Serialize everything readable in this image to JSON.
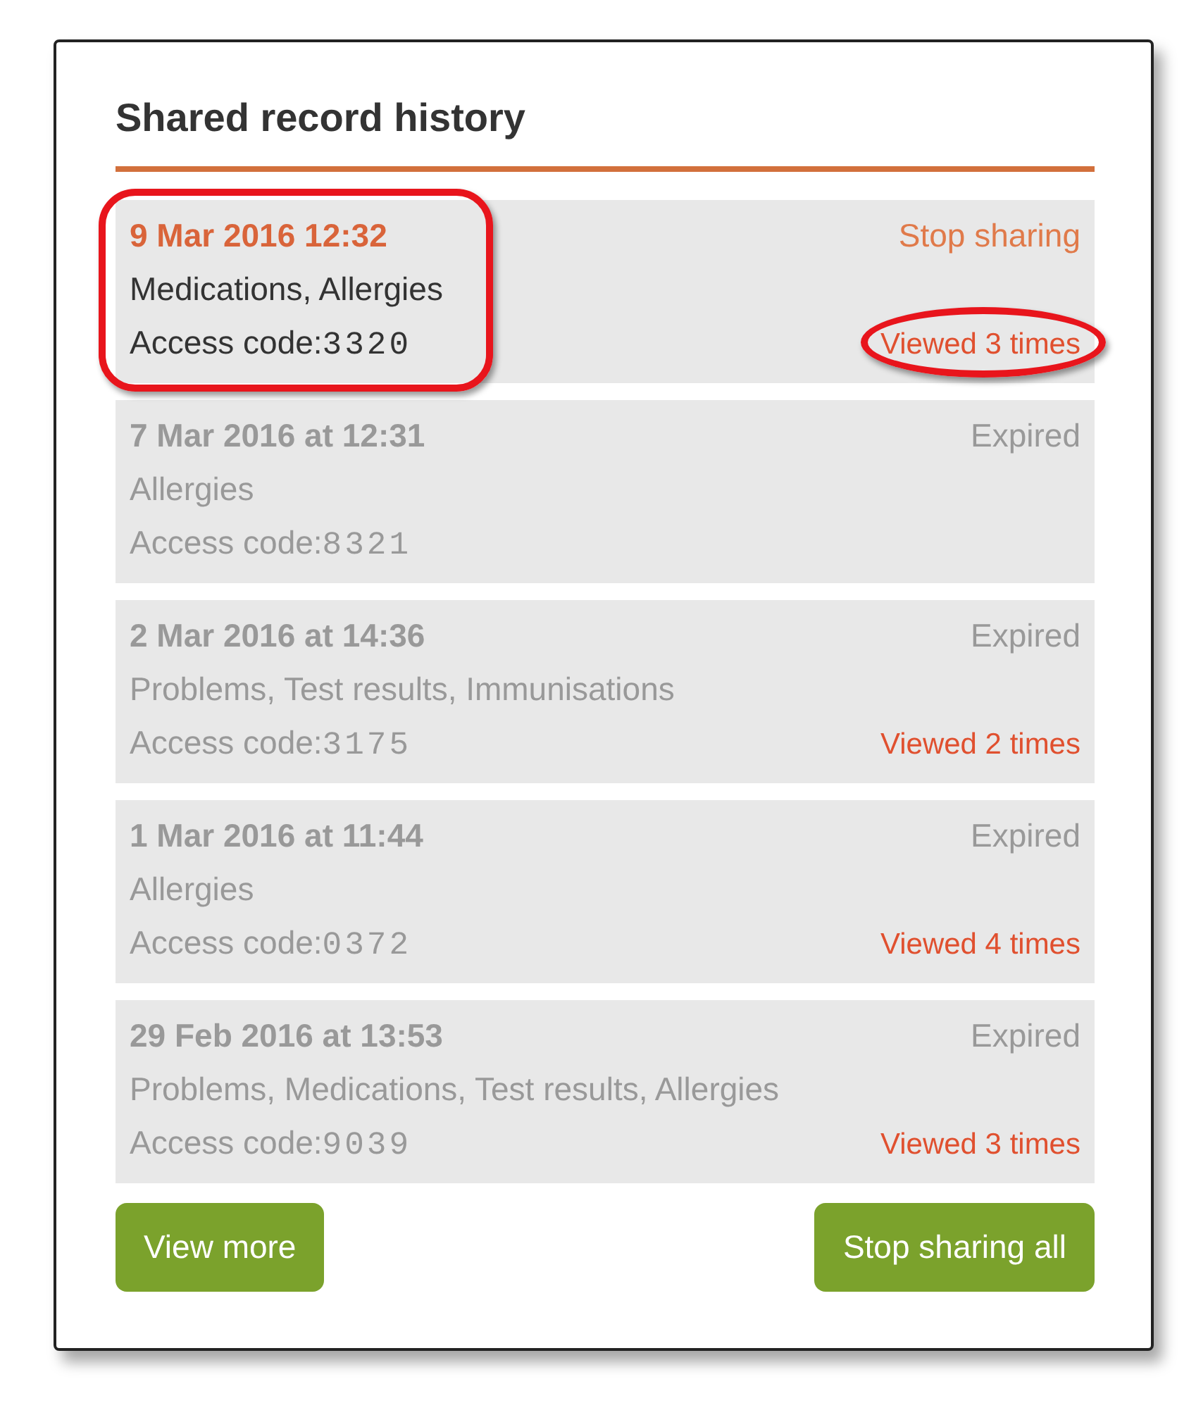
{
  "title": "Shared record history",
  "records": [
    {
      "kind": "active",
      "date": "9 Mar 2016 12:32",
      "items": "Medications, Allergies",
      "code_label": "Access code:",
      "code": "3320",
      "status": "Stop sharing",
      "viewed": "Viewed 3 times",
      "highlighted": true
    },
    {
      "kind": "expired",
      "date": "7 Mar 2016 at 12:31",
      "items": "Allergies",
      "code_label": "Access code:",
      "code": "8321",
      "status": "Expired",
      "highlighted": false
    },
    {
      "kind": "expired",
      "date": "2 Mar 2016 at 14:36",
      "items": "Problems, Test results, Immunisations",
      "code_label": "Access code:",
      "code": "3175",
      "status": "Expired",
      "viewed": "Viewed 2 times",
      "highlighted": false
    },
    {
      "kind": "expired",
      "date": "1 Mar 2016 at 11:44",
      "items": "Allergies",
      "code_label": "Access code:",
      "code": "0372",
      "status": "Expired",
      "viewed": "Viewed 4 times",
      "highlighted": false
    },
    {
      "kind": "expired",
      "date": "29 Feb 2016 at 13:53",
      "items": "Problems, Medications, Test results, Allergies",
      "code_label": "Access code:",
      "code": "9039",
      "status": "Expired",
      "viewed": "Viewed 3 times",
      "highlighted": false
    }
  ],
  "buttons": [
    "View more",
    "Stop sharing all"
  ]
}
